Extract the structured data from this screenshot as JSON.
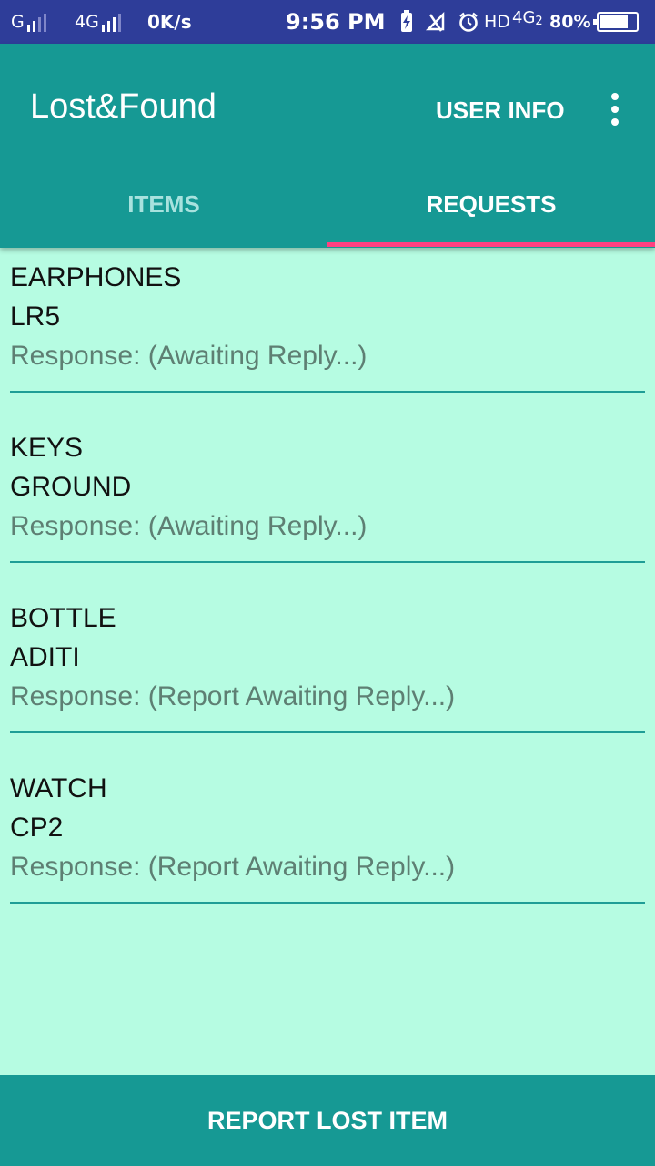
{
  "status_bar": {
    "sim1_label": "G",
    "sim2_label": "4G",
    "speed": "0K/s",
    "time": "9:56 PM",
    "hd_label": "HD",
    "net_label": "4G",
    "net_sub": "2",
    "battery_percent": "80%",
    "battery_level": 0.8,
    "icons": [
      "charging-icon",
      "mute-icon",
      "alarm-icon"
    ]
  },
  "app_bar": {
    "title": "Lost&Found",
    "user_info_label": "USER INFO",
    "overflow_icon": "more-vert-icon"
  },
  "tabs": [
    {
      "label": "ITEMS",
      "selected": false
    },
    {
      "label": "REQUESTS",
      "selected": true
    }
  ],
  "requests": [
    {
      "item": "EARPHONES",
      "place": "LR5",
      "response": "Response: (Awaiting Reply...)"
    },
    {
      "item": "KEYS",
      "place": "GROUND",
      "response": "Response: (Awaiting Reply...)"
    },
    {
      "item": "BOTTLE",
      "place": "ADITI",
      "response": "Response: (Report Awaiting Reply...)"
    },
    {
      "item": "WATCH",
      "place": "CP2",
      "response": "Response: (Report Awaiting Reply...)"
    }
  ],
  "footer": {
    "report_button_label": "REPORT LOST ITEM"
  },
  "colors": {
    "status_bar": "#2e3d99",
    "primary": "#169994",
    "background": "#b6fce2",
    "tab_indicator": "#ff4081"
  }
}
